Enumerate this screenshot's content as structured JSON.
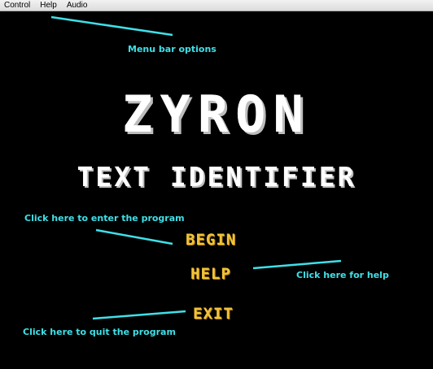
{
  "menubar": {
    "items": [
      {
        "label": "Control"
      },
      {
        "label": "Help"
      },
      {
        "label": "Audio"
      }
    ]
  },
  "game": {
    "title": "ZYRON",
    "subtitle": "TEXT IDENTIFIER",
    "buttons": {
      "begin": "BEGIN",
      "help": "HELP",
      "exit": "EXIT"
    }
  },
  "annotations": {
    "menu_note": "Menu bar options",
    "begin_note": "Click here to enter the program",
    "help_note": "Click here for help",
    "exit_note": "Click here to quit the program"
  },
  "colors": {
    "background": "#000000",
    "menubar": "#e8e8e8",
    "title_text": "#ffffff",
    "button_text": "#f2c23a",
    "annotation": "#3fe0e8"
  }
}
